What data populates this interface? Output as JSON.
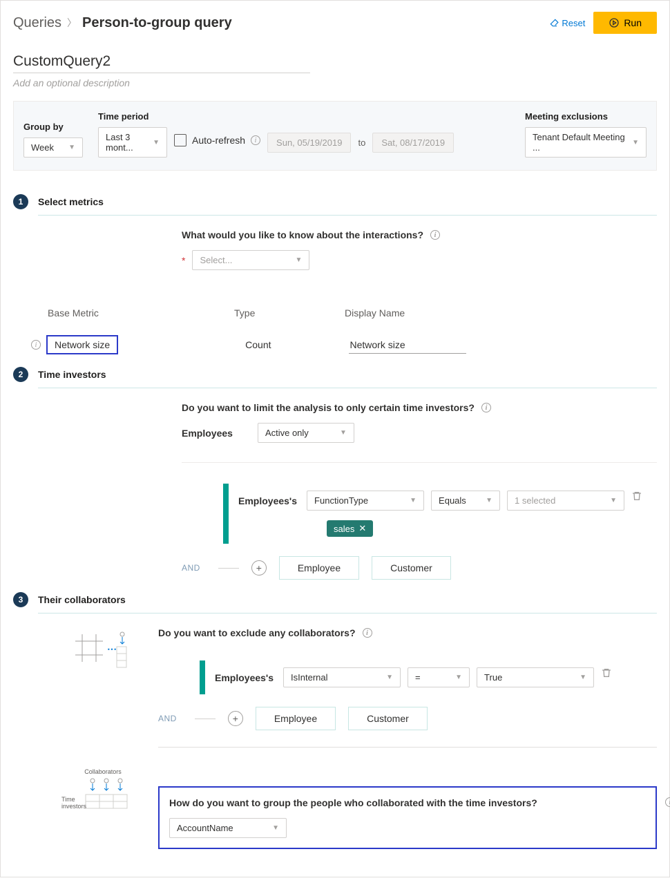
{
  "breadcrumb": {
    "root": "Queries",
    "current": "Person-to-group query"
  },
  "actions": {
    "reset": "Reset",
    "run": "Run"
  },
  "query": {
    "name": "CustomQuery2",
    "descPlaceholder": "Add an optional description"
  },
  "params": {
    "groupByLabel": "Group by",
    "groupByValue": "Week",
    "timePeriodLabel": "Time period",
    "timePeriodValue": "Last 3 mont...",
    "autoRefresh": "Auto-refresh",
    "dateFrom": "Sun, 05/19/2019",
    "to": "to",
    "dateTo": "Sat, 08/17/2019",
    "exclusionsLabel": "Meeting exclusions",
    "exclusionsValue": "Tenant Default Meeting ..."
  },
  "section1": {
    "num": "1",
    "title": "Select metrics",
    "prompt": "What would you like to know about the interactions?",
    "selectPlaceholder": "Select...",
    "headers": {
      "base": "Base Metric",
      "type": "Type",
      "display": "Display Name"
    },
    "row": {
      "base": "Network size",
      "type": "Count",
      "display": "Network size"
    }
  },
  "section2": {
    "num": "2",
    "title": "Time investors",
    "prompt": "Do you want to limit the analysis to only certain time investors?",
    "employeesLabel": "Employees",
    "employeesValue": "Active only",
    "filterLabel": "Employees's",
    "attr": "FunctionType",
    "op": "Equals",
    "valSummary": "1 selected",
    "tag": "sales",
    "and": "AND",
    "employeeBtn": "Employee",
    "customerBtn": "Customer"
  },
  "section3": {
    "num": "3",
    "title": "Their collaborators",
    "prompt": "Do you want to exclude any collaborators?",
    "filterLabel": "Employees's",
    "attr": "IsInternal",
    "op": "=",
    "val": "True",
    "and": "AND",
    "employeeBtn": "Employee",
    "customerBtn": "Customer",
    "groupPrompt": "How do you want to group the people who collaborated with the time investors?",
    "groupValue": "AccountName",
    "diagLabels": {
      "collab": "Collaborators",
      "time": "Time\ninvestors"
    }
  }
}
